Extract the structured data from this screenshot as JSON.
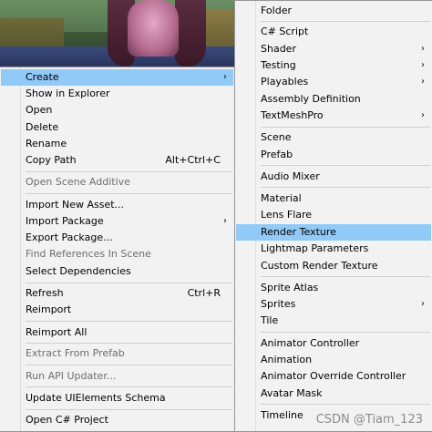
{
  "left_menu": {
    "items": [
      {
        "label": "Create",
        "arrow": "›",
        "highlight": true
      },
      {
        "label": "Show in Explorer"
      },
      {
        "label": "Open"
      },
      {
        "label": "Delete"
      },
      {
        "label": "Rename"
      },
      {
        "label": "Copy Path",
        "shortcut": "Alt+Ctrl+C"
      },
      {
        "label": "Open Scene Additive",
        "disabled": true
      },
      {
        "label": "Import New Asset..."
      },
      {
        "label": "Import Package",
        "arrow": "›"
      },
      {
        "label": "Export Package..."
      },
      {
        "label": "Find References In Scene",
        "disabled": true
      },
      {
        "label": "Select Dependencies"
      },
      {
        "label": "Refresh",
        "shortcut": "Ctrl+R"
      },
      {
        "label": "Reimport"
      },
      {
        "label": "Reimport All"
      },
      {
        "label": "Extract From Prefab",
        "disabled": true
      },
      {
        "label": "Run API Updater...",
        "disabled": true
      },
      {
        "label": "Update UIElements Schema"
      },
      {
        "label": "Open C# Project"
      }
    ]
  },
  "right_menu": {
    "items": [
      {
        "label": "Folder"
      },
      {
        "label": "C# Script"
      },
      {
        "label": "Shader",
        "arrow": "›"
      },
      {
        "label": "Testing",
        "arrow": "›"
      },
      {
        "label": "Playables",
        "arrow": "›"
      },
      {
        "label": "Assembly Definition"
      },
      {
        "label": "TextMeshPro",
        "arrow": "›"
      },
      {
        "label": "Scene"
      },
      {
        "label": "Prefab"
      },
      {
        "label": "Audio Mixer"
      },
      {
        "label": "Material"
      },
      {
        "label": "Lens Flare"
      },
      {
        "label": "Render Texture",
        "highlight": true
      },
      {
        "label": "Lightmap Parameters"
      },
      {
        "label": "Custom Render Texture"
      },
      {
        "label": "Sprite Atlas"
      },
      {
        "label": "Sprites",
        "arrow": "›"
      },
      {
        "label": "Tile"
      },
      {
        "label": "Animator Controller"
      },
      {
        "label": "Animation"
      },
      {
        "label": "Animator Override Controller"
      },
      {
        "label": "Avatar Mask"
      },
      {
        "label": "Timeline"
      }
    ]
  },
  "watermark": "CSDN @Tiam_123",
  "colors": {
    "highlight": "#91c9f7",
    "menu_bg": "#f2f2f2",
    "disabled_text": "#6d6d6d"
  }
}
